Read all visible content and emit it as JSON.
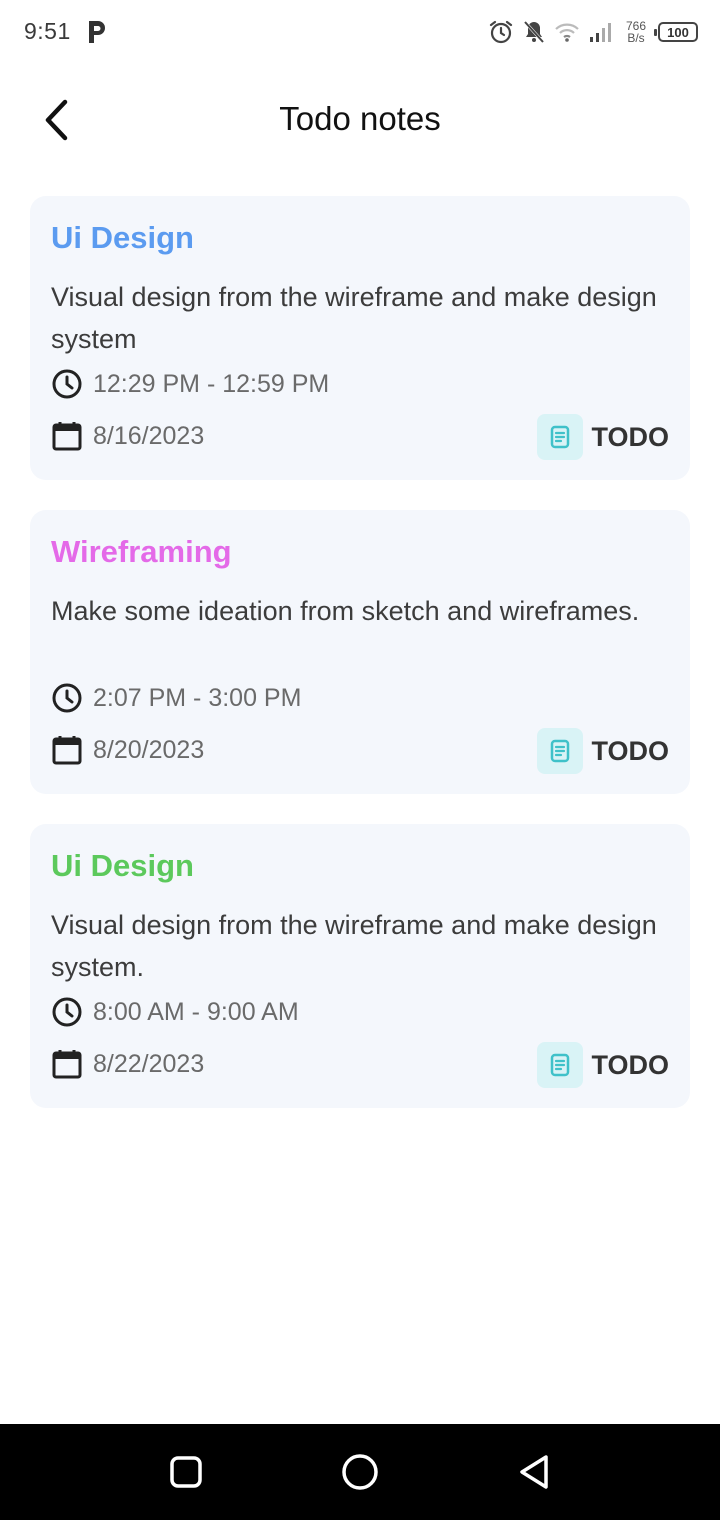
{
  "status_bar": {
    "time": "9:51",
    "net_speed_value": "766",
    "net_speed_unit": "B/s",
    "battery": "100"
  },
  "header": {
    "title": "Todo notes"
  },
  "notes": [
    {
      "title": "Ui Design",
      "title_color": "#5b9bf0",
      "description": "Visual design from the wireframe and make design system",
      "time_range": "12:29 PM - 12:59 PM",
      "date": "8/16/2023",
      "status": "TODO"
    },
    {
      "title": "Wireframing",
      "title_color": "#e46ae8",
      "description": "Make some ideation from sketch and wireframes.",
      "time_range": "2:07 PM - 3:00 PM",
      "date": "8/20/2023",
      "status": "TODO"
    },
    {
      "title": "Ui Design",
      "title_color": "#5cc95c",
      "description": "Visual design from the wireframe and make design system.",
      "time_range": "8:00 AM - 9:00 AM",
      "date": "8/22/2023",
      "status": "TODO"
    }
  ],
  "icons": {
    "back": "chevron-left-icon",
    "clock": "clock-icon",
    "calendar": "calendar-icon",
    "status": "document-icon",
    "nav_recents": "square-icon",
    "nav_home": "circle-icon",
    "nav_back": "triangle-back-icon"
  },
  "colors": {
    "card_background": "#f4f7fc",
    "chip_background": "#d9f3f6",
    "chip_icon": "#3fc1c9"
  }
}
